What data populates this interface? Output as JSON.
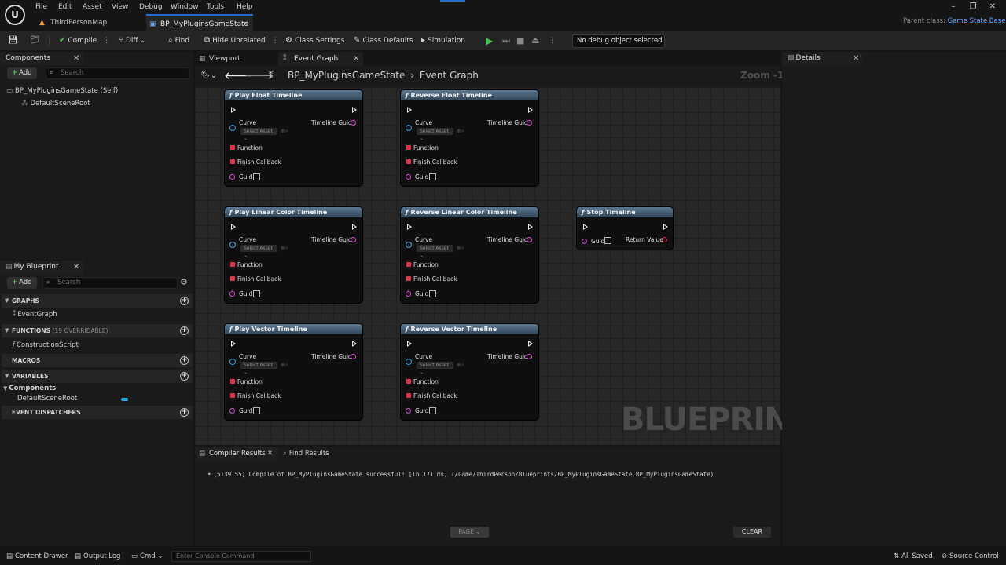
{
  "menu": [
    "File",
    "Edit",
    "Asset",
    "View",
    "Debug",
    "Window",
    "Tools",
    "Help"
  ],
  "tabs": [
    {
      "label": "ThirdPersonMap"
    },
    {
      "label": "BP_MyPluginsGameState"
    }
  ],
  "parent_class": {
    "label": "Parent class:",
    "value": "Game State Base"
  },
  "toolbar": {
    "compile": "Compile",
    "diff": "Diff",
    "find": "Find",
    "hide_unrelated": "Hide Unrelated",
    "class_settings": "Class Settings",
    "class_defaults": "Class Defaults",
    "simulation": "Simulation",
    "debug_object": "No debug object selected"
  },
  "components": {
    "title": "Components",
    "add": "Add",
    "search_placeholder": "Search",
    "items": [
      "BP_MyPluginsGameState (Self)",
      "DefaultSceneRoot"
    ]
  },
  "my_blueprint": {
    "title": "My Blueprint",
    "add": "Add",
    "search_placeholder": "Search",
    "sections": {
      "graphs": "GRAPHS",
      "graph_item": "EventGraph",
      "functions": "FUNCTIONS",
      "functions_sub": "(19 OVERRIDABLE)",
      "function_item": "ConstructionScript",
      "macros": "MACROS",
      "variables": "VARIABLES",
      "components": "Components",
      "variable_item": "DefaultSceneRoot",
      "event_dispatchers": "EVENT DISPATCHERS"
    }
  },
  "editor_tabs": {
    "viewport": "Viewport",
    "event_graph": "Event Graph"
  },
  "breadcrumb": {
    "asset": "BP_MyPluginsGameState",
    "graph": "Event Graph"
  },
  "zoom": "Zoom -1",
  "watermark": "BLUEPRINT",
  "pin_labels": {
    "curve": "Curve",
    "select_asset": "Select Asset",
    "timeline_guid": "Timeline Guid",
    "function": "Function",
    "finish_callback": "Finish Callback",
    "guid": "Guid",
    "return_value": "Return Value"
  },
  "nodes": {
    "n1": "Play Float Timeline",
    "n2": "Reverse Float Timeline",
    "n3": "Play Linear Color Timeline",
    "n4": "Reverse Linear Color Timeline",
    "n5": "Stop Timeline",
    "n6": "Play Vector Timeline",
    "n7": "Reverse Vector Timeline"
  },
  "compiler": {
    "tab": "Compiler Results",
    "find_tab": "Find Results",
    "message": "[5139.55] Compile of BP_MyPluginsGameState successful! [in 171 ms] (/Game/ThirdPerson/Blueprints/BP_MyPluginsGameState.BP_MyPluginsGameState)",
    "page": "PAGE",
    "clear": "CLEAR"
  },
  "details": {
    "title": "Details"
  },
  "status": {
    "content_drawer": "Content Drawer",
    "output_log": "Output Log",
    "cmd": "Cmd",
    "console_placeholder": "Enter Console Command",
    "all_saved": "All Saved",
    "source_control": "Source Control"
  },
  "colors": {
    "accent": "#2a6cd2",
    "node_header": "#4a6177",
    "exec_pin": "#e8e8e8",
    "struct_pin": "#d24bd2",
    "delegate_pin": "#e0304a",
    "object_pin": "#2aa6d8",
    "play_green": "#4bc24b"
  }
}
